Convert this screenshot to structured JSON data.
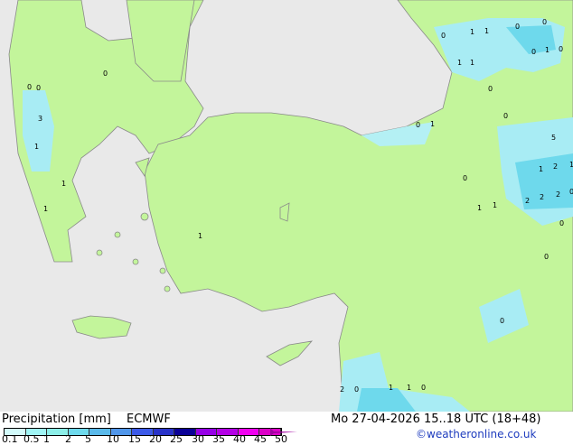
{
  "title": "Precipitation [mm]",
  "model": "ECMWF",
  "datetime": "Mo 27-04-2026 15..18 UTC (18+48)",
  "credit": "©weatheronline.co.uk",
  "colors": {
    "sea": "#e9e9e9",
    "land": "#c3f59b",
    "border": "#8a8a8a",
    "rain_light": "#c8f4f4",
    "rain_med": "#96e6f0",
    "rain_heavy": "#5fcdea"
  },
  "scale": {
    "ticks": [
      "0.1",
      "0.5",
      "1",
      "2",
      "5",
      "10",
      "15",
      "20",
      "25",
      "30",
      "35",
      "40",
      "45",
      "50"
    ],
    "colors": [
      "#d2fafa",
      "#a0f5f5",
      "#8ceee8",
      "#6ed9ec",
      "#5ab9ea",
      "#5096ea",
      "#3c5ae8",
      "#2832c8",
      "#0a0096",
      "#9600e6",
      "#b400e6",
      "#f000f0",
      "#dc00c8"
    ]
  },
  "map_labels": [
    "0",
    "1",
    "1",
    "0",
    "0",
    "0",
    "1",
    "0",
    "1",
    "1",
    "0",
    "0",
    "0",
    "3",
    "1",
    "1",
    "1",
    "0",
    "0",
    "0",
    "1",
    "0",
    "5",
    "1",
    "2",
    "1",
    "2",
    "2",
    "2",
    "1",
    "1",
    "0",
    "0",
    "1",
    "0",
    "2",
    "0",
    "1",
    "1",
    "0",
    "0"
  ]
}
